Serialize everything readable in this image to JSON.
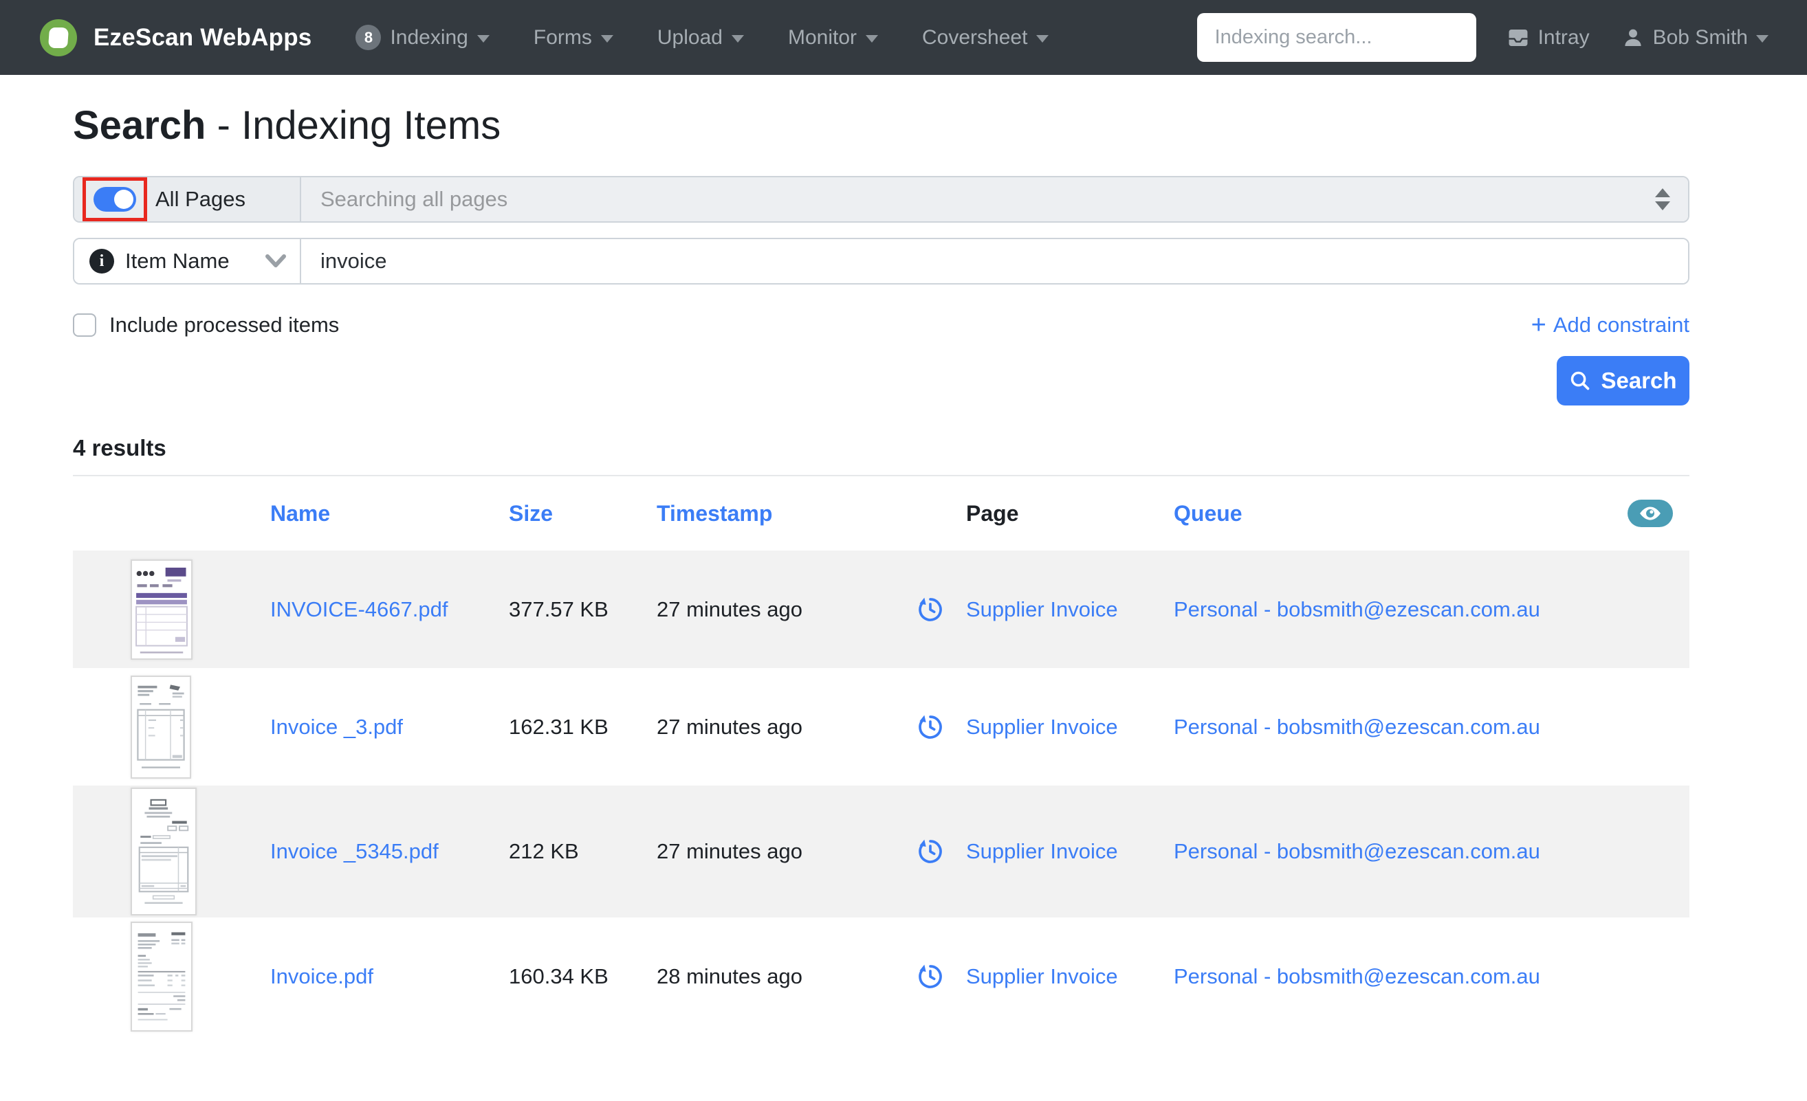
{
  "navbar": {
    "brand": "EzeScan WebApps",
    "badge_count": "8",
    "items": [
      {
        "label": "Indexing"
      },
      {
        "label": "Forms"
      },
      {
        "label": "Upload"
      },
      {
        "label": "Monitor"
      },
      {
        "label": "Coversheet"
      }
    ],
    "search_placeholder": "Indexing search...",
    "intray_label": "Intray",
    "user_name": "Bob Smith"
  },
  "page": {
    "title": "Search",
    "subtitle": "- Indexing Items",
    "all_pages_label": "All Pages",
    "pages_select_value": "Searching all pages",
    "field_selector_label": "Item Name",
    "search_term": "invoice",
    "include_processed_label": "Include processed items",
    "add_constraint_plus": "+",
    "add_constraint_label": "Add constraint",
    "search_button_label": "Search",
    "results_count": "4 results"
  },
  "icons": {
    "info_glyph": "i"
  },
  "table": {
    "headers": {
      "name": "Name",
      "size": "Size",
      "timestamp": "Timestamp",
      "page": "Page",
      "queue": "Queue"
    },
    "rows": [
      {
        "name": "INVOICE-4667.pdf",
        "size": "377.57 KB",
        "timestamp": "27 minutes ago",
        "page": "Supplier Invoice",
        "queue": "Personal - bobsmith@ezescan.com.au"
      },
      {
        "name": "Invoice _3.pdf",
        "size": "162.31 KB",
        "timestamp": "27 minutes ago",
        "page": "Supplier Invoice",
        "queue": "Personal - bobsmith@ezescan.com.au"
      },
      {
        "name": "Invoice _5345.pdf",
        "size": "212 KB",
        "timestamp": "27 minutes ago",
        "page": "Supplier Invoice",
        "queue": "Personal - bobsmith@ezescan.com.au"
      },
      {
        "name": "Invoice.pdf",
        "size": "160.34 KB",
        "timestamp": "28 minutes ago",
        "page": "Supplier Invoice",
        "queue": "Personal - bobsmith@ezescan.com.au"
      }
    ]
  },
  "colors": {
    "primary_blue": "#3b7df6",
    "navbar_bg": "#343a40",
    "stripe_gray": "#f2f2f2",
    "annotation_red": "#e8281f",
    "eye_badge_teal": "#4a9db5",
    "addon_gray": "#e9ecef"
  }
}
